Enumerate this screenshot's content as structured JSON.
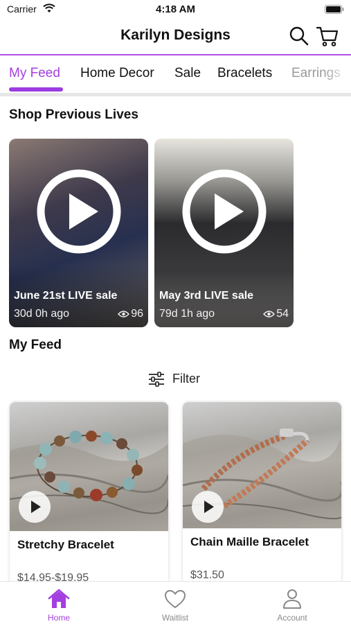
{
  "status_bar": {
    "carrier": "Carrier",
    "time": "4:18 AM"
  },
  "header": {
    "title": "Karilyn Designs",
    "search_icon": "search-icon",
    "cart_icon": "cart-icon"
  },
  "tabs": [
    {
      "label": "My Feed",
      "active": true
    },
    {
      "label": "Home Decor",
      "active": false
    },
    {
      "label": "Sale",
      "active": false
    },
    {
      "label": "Bracelets",
      "active": false
    },
    {
      "label": "Earrings",
      "active": false
    }
  ],
  "previous_lives": {
    "title": "Shop Previous Lives",
    "items": [
      {
        "title": "June 21st LIVE sale",
        "ago": "30d 0h ago",
        "views": "96"
      },
      {
        "title": "May 3rd LIVE sale",
        "ago": "79d 1h ago",
        "views": "54"
      }
    ]
  },
  "feed": {
    "title": "My Feed",
    "filter_label": "Filter",
    "products": [
      {
        "name": "Stretchy Bracelet",
        "price": "$14.95-$19.95"
      },
      {
        "name": "Chain Maille Bracelet",
        "price": "$31.50"
      }
    ]
  },
  "bottom_nav": {
    "items": [
      {
        "label": "Home",
        "icon": "home-icon",
        "active": true
      },
      {
        "label": "Waitlist",
        "icon": "heart-icon",
        "active": false
      },
      {
        "label": "Account",
        "icon": "person-icon",
        "active": false
      }
    ]
  },
  "colors": {
    "accent": "#a43fe0",
    "divider": "#b24ee8",
    "text": "#111111",
    "muted": "#888888"
  }
}
